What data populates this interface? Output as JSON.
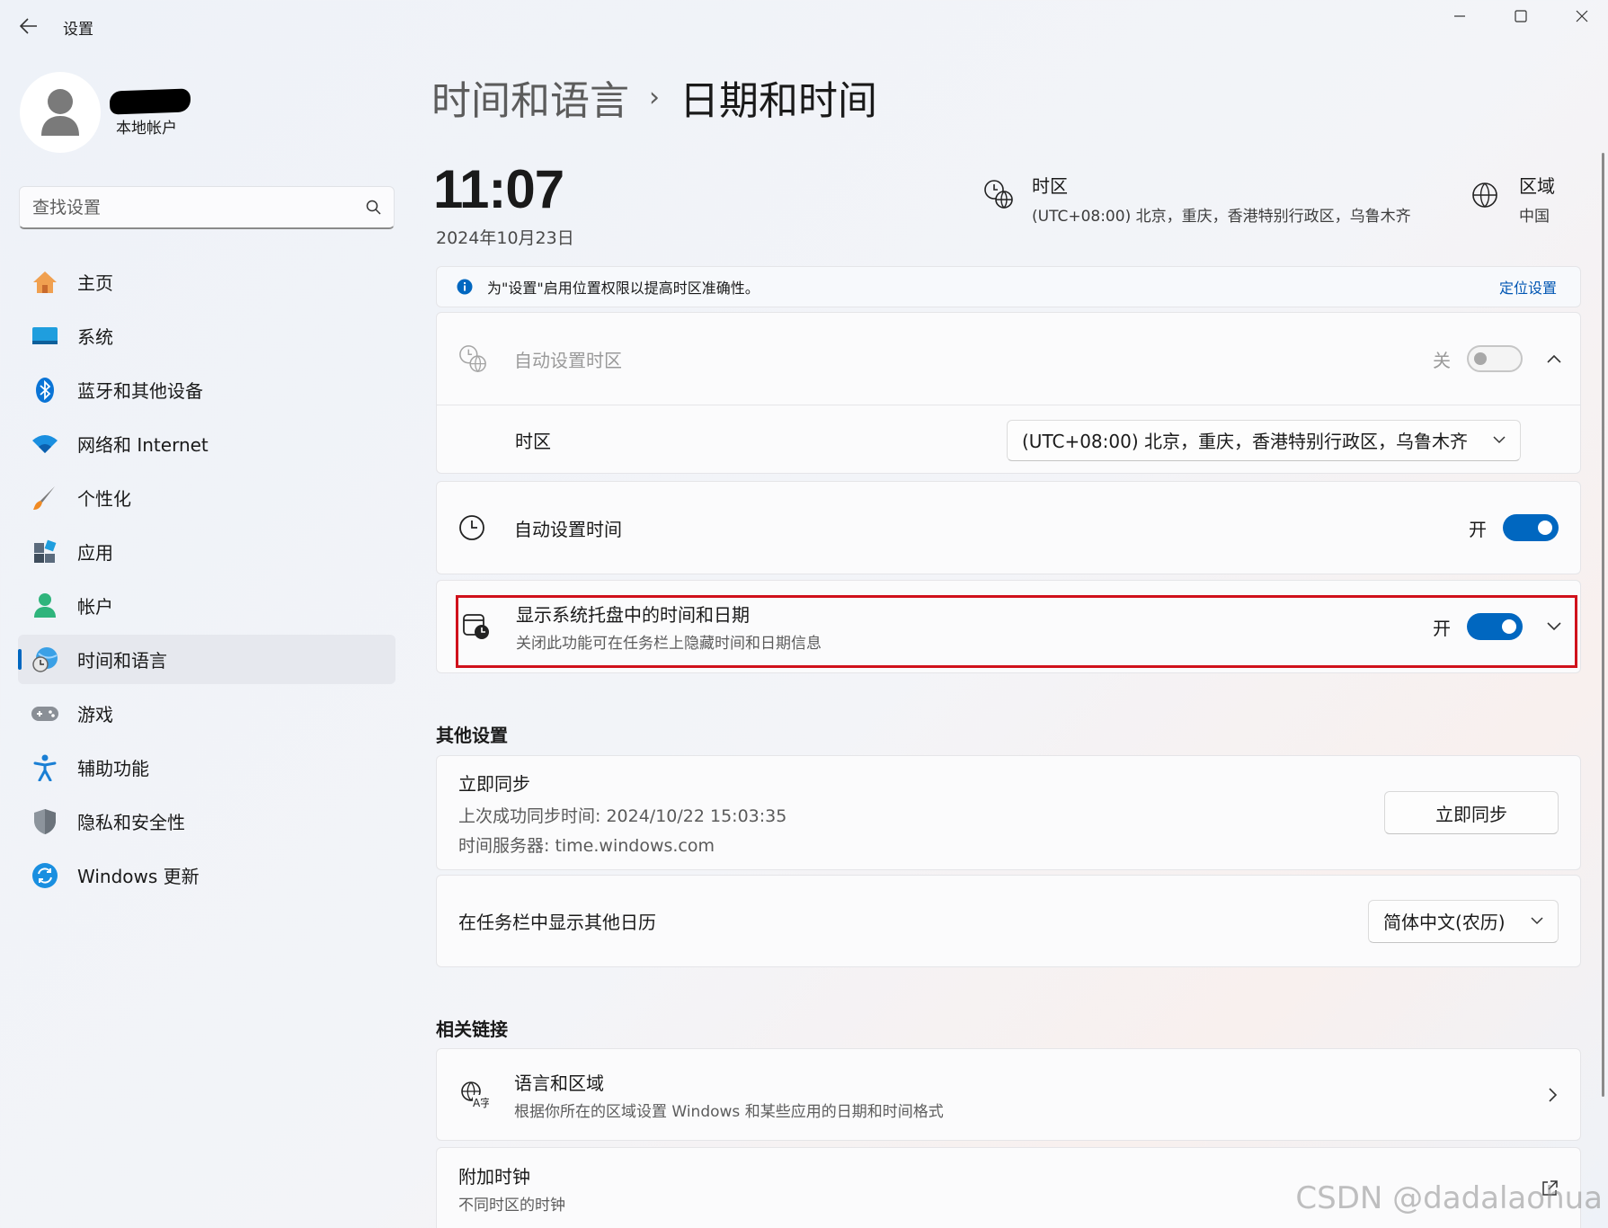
{
  "window": {
    "title": "设置"
  },
  "user": {
    "type": "本地帐户"
  },
  "search": {
    "placeholder": "查找设置"
  },
  "sidebar": {
    "items": [
      {
        "label": "主页",
        "icon": "home-icon"
      },
      {
        "label": "系统",
        "icon": "system-icon"
      },
      {
        "label": "蓝牙和其他设备",
        "icon": "bluetooth-icon"
      },
      {
        "label": "网络和 Internet",
        "icon": "wifi-icon"
      },
      {
        "label": "个性化",
        "icon": "brush-icon"
      },
      {
        "label": "应用",
        "icon": "apps-icon"
      },
      {
        "label": "帐户",
        "icon": "account-icon"
      },
      {
        "label": "时间和语言",
        "icon": "time-language-icon",
        "active": true
      },
      {
        "label": "游戏",
        "icon": "gamepad-icon"
      },
      {
        "label": "辅助功能",
        "icon": "accessibility-icon"
      },
      {
        "label": "隐私和安全性",
        "icon": "shield-icon"
      },
      {
        "label": "Windows 更新",
        "icon": "update-icon"
      }
    ]
  },
  "header": {
    "parent": "时间和语言",
    "separator": "›",
    "current": "日期和时间"
  },
  "clock": {
    "time": "11:07",
    "date": "2024年10月23日"
  },
  "timezone_info": {
    "title": "时区",
    "value": "(UTC+08:00) 北京，重庆，香港特别行政区，乌鲁木齐"
  },
  "region_info": {
    "title": "区域",
    "value": "中国"
  },
  "infobar": {
    "message": "为\"设置\"启用位置权限以提高时区准确性。",
    "link": "定位设置"
  },
  "auto_timezone": {
    "title": "自动设置时区",
    "state": "关"
  },
  "timezone_row": {
    "label": "时区",
    "selected": "(UTC+08:00) 北京，重庆，香港特别行政区，乌鲁木齐"
  },
  "auto_time": {
    "title": "自动设置时间",
    "state": "开"
  },
  "tray_clock": {
    "title": "显示系统托盘中的时间和日期",
    "subtitle": "关闭此功能可在任务栏上隐藏时间和日期信息",
    "state": "开"
  },
  "other_settings": {
    "heading": "其他设置",
    "sync": {
      "title": "立即同步",
      "last_sync": "上次成功同步时间: 2024/10/22 15:03:35",
      "server": "时间服务器: time.windows.com",
      "button": "立即同步"
    },
    "calendar": {
      "title": "在任务栏中显示其他日历",
      "selected": "简体中文(农历)"
    }
  },
  "related_links": {
    "heading": "相关链接",
    "language_region": {
      "title": "语言和区域",
      "subtitle": "根据你所在的区域设置 Windows 和某些应用的日期和时间格式"
    },
    "additional_clocks": {
      "title": "附加时钟",
      "subtitle": "不同时区的时钟"
    }
  },
  "watermark": "CSDN @dadalaohua",
  "colors": {
    "accent": "#0067c0",
    "highlight": "#d0111b"
  }
}
